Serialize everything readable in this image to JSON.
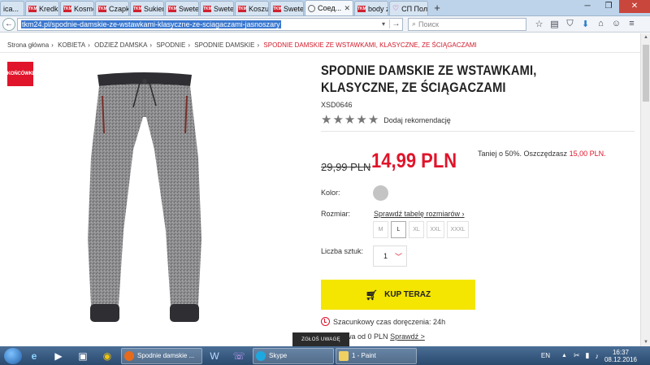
{
  "browser": {
    "tabs": [
      {
        "label": "ica...",
        "icon": "partial"
      },
      {
        "label": "Kredka d...",
        "icon": "tkm-favicon"
      },
      {
        "label": "Kosmety...",
        "icon": "tkm-favicon"
      },
      {
        "label": "Czapka d...",
        "icon": "tkm-favicon"
      },
      {
        "label": "Sukienka ...",
        "icon": "tkm-favicon"
      },
      {
        "label": "Sweter m...",
        "icon": "tkm-favicon"
      },
      {
        "label": "Sweter m...",
        "icon": "tkm-favicon"
      },
      {
        "label": "Koszula ...",
        "icon": "tkm-favicon"
      },
      {
        "label": "Sweter m...",
        "icon": "tkm-favicon"
      },
      {
        "label": "Соед...",
        "icon": "globe-icon",
        "active": true
      },
      {
        "label": "body z dł...",
        "icon": "tkm-favicon"
      },
      {
        "label": "СП Польш...",
        "icon": "heart-icon"
      }
    ],
    "favicon_text": "TKM",
    "url": "tkm24.pl/spodnie-damskie-ze-wstawkami-klasyczne-ze-sciagaczami-jasnoszary",
    "search_placeholder": "Поиск"
  },
  "breadcrumb": [
    {
      "label": "Strona główna"
    },
    {
      "label": "KOBIETA"
    },
    {
      "label": "ODZIEŻ DAMSKA"
    },
    {
      "label": "SPODNIE"
    },
    {
      "label": "SPODNIE DAMSKIE"
    },
    {
      "label": "SPODNIE DAMSKIE ZE WSTAWKAMI, KLASYCZNE, ZE ŚCIĄGACZAMI",
      "current": true
    }
  ],
  "badge": "KOŃCÓWKI",
  "product": {
    "title": "SPODNIE DAMSKIE ZE WSTAWKAMI, KLASYCZNE, ZE ŚCIĄGACZAMI",
    "sku": "XSD0646",
    "rating_stars": 5,
    "recommend_label": "Dodaj rekomendację",
    "old_price": "29,99 PLN",
    "new_price": "14,99 PLN",
    "savings_text": "Taniej o 50%. Oszczędzasz",
    "savings_amount": "15,00 PLN.",
    "color_label": "Kolor:",
    "color_value": "#c4c4c4",
    "size_label": "Rozmiar:",
    "size_chart_link": "Sprawdź tabelę rozmiarów ›",
    "sizes": [
      "M",
      "L",
      "XL",
      "XXL",
      "XXXL"
    ],
    "selected_size": "L",
    "qty_label": "Liczba sztuk:",
    "qty_value": "1",
    "buy_label": "KUP TERAZ",
    "delivery_text": "Szacunkowy czas doręczenia: 24h",
    "shipping_text": "awa od 0 PLN",
    "shipping_link": "Sprawdź >"
  },
  "report_button": "ZGŁOŚ UWAGĘ",
  "taskbar": {
    "tasks": [
      {
        "label": "Spodnie damskie ...",
        "icon": "firefox-icon"
      },
      {
        "label": "Skype",
        "icon": "skype-icon"
      },
      {
        "label": "1 - Paint",
        "icon": "paint-icon"
      }
    ],
    "language": "EN",
    "time": "16:37",
    "date": "08.12.2016"
  },
  "colors": {
    "accent_red": "#e0142a",
    "buy_yellow": "#f4e600"
  }
}
